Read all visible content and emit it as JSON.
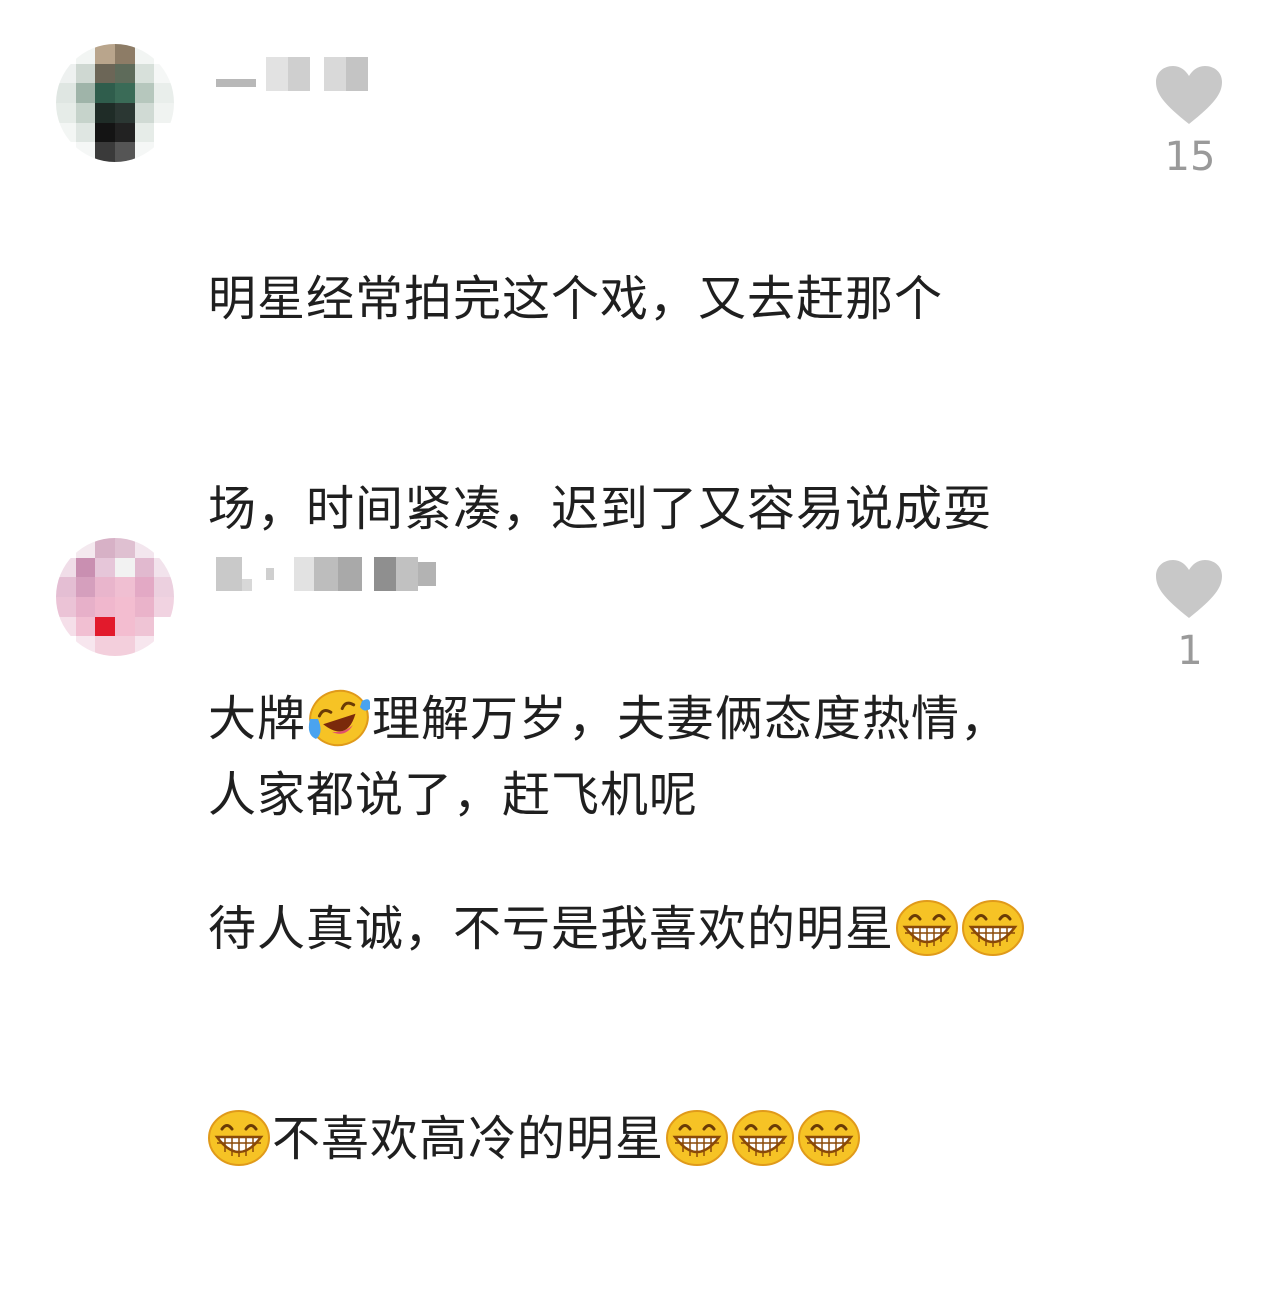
{
  "comments": [
    {
      "lines": [
        "明星经常拍完这个戏，又去赶那个",
        "场，时间紧凑，迟到了又容易说成耍",
        "大牌",
        "理解万岁，夫妻俩态度热情，",
        "待人真诚，不亏是我喜欢的明星",
        "不喜欢高冷的明星"
      ],
      "likes": "15",
      "avatar_icon": "pixelated-avatar",
      "username_icon": "blurred-username"
    },
    {
      "lines": [
        "人家都说了，赶飞机呢"
      ],
      "likes": "1",
      "avatar_icon": "pixelated-avatar",
      "username_icon": "blurred-username"
    }
  ],
  "icons": {
    "like": "heart-icon",
    "laugh_cry": "laugh-cry-emoji-icon",
    "grin": "grin-emoji-icon"
  },
  "colors": {
    "text": "#1f1f1f",
    "like": "#c8c8c8",
    "count": "#9a9a9a"
  }
}
